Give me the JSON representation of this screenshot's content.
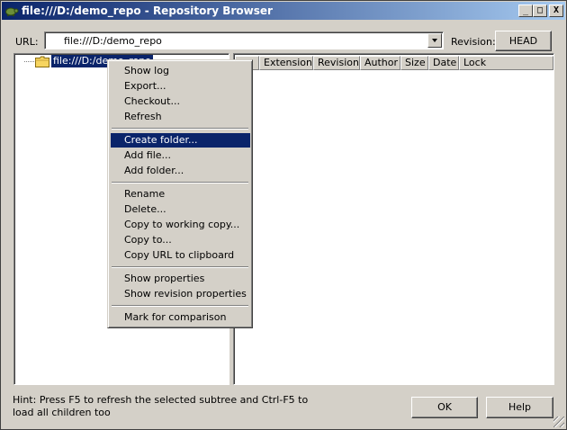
{
  "window": {
    "title": "file:///D:/demo_repo - Repository Browser"
  },
  "controls": {
    "minimize": "_",
    "maximize": "□",
    "close": "X"
  },
  "url_label": "URL:",
  "url_value": "file:///D:/demo_repo",
  "revision_label": "Revision:",
  "revision_button": "HEAD",
  "tree": {
    "root_label": "file:///D:/demo_repo"
  },
  "columns": [
    "",
    "Extension",
    "Revision",
    "Author",
    "Size",
    "Date",
    "Lock"
  ],
  "context_menu": {
    "items": [
      "Show log",
      "Export...",
      "Checkout...",
      "Refresh",
      "Create folder...",
      "Add file...",
      "Add folder...",
      "Rename",
      "Delete...",
      "Copy to working copy...",
      "Copy to...",
      "Copy URL to clipboard",
      "Show properties",
      "Show revision properties",
      "Mark for comparison"
    ],
    "selected": "Create folder..."
  },
  "hint": "Hint: Press F5 to refresh the selected subtree and Ctrl-F5 to load all children too",
  "buttons": {
    "ok": "OK",
    "help": "Help"
  },
  "colors": {
    "title_start": "#0a246a",
    "title_end": "#a6caf0",
    "selection": "#0a246a",
    "face": "#d4d0c8"
  },
  "icons": [
    "tortoise-app-icon",
    "folder-icon"
  ]
}
